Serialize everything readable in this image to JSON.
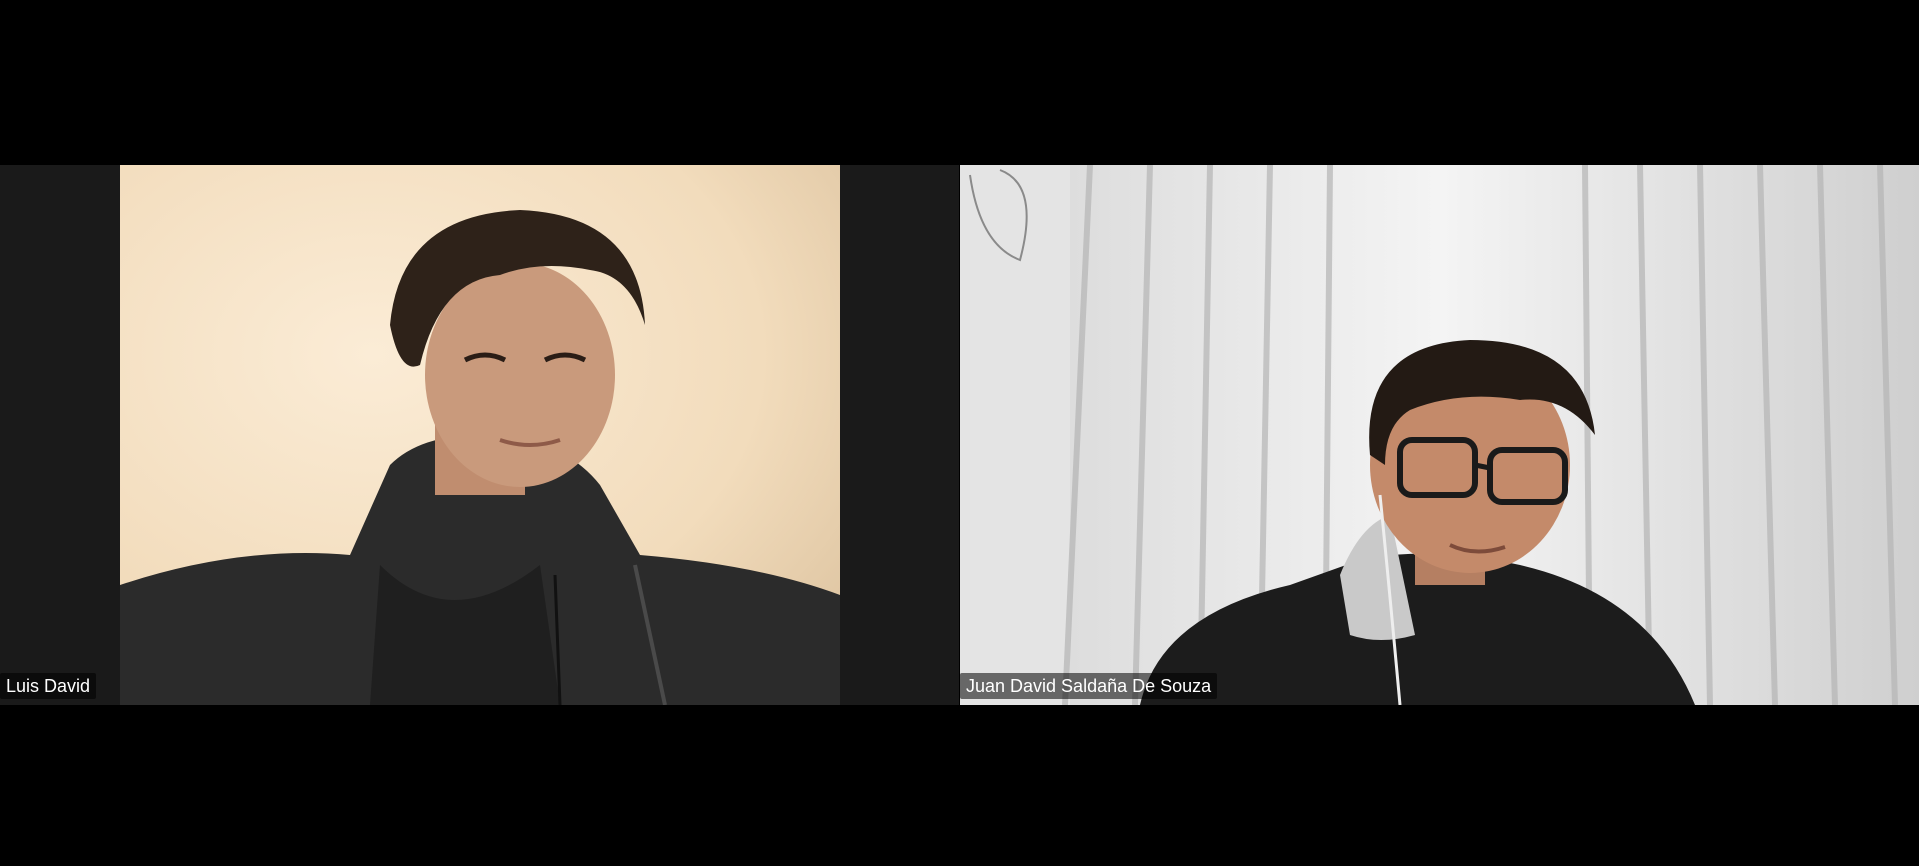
{
  "meeting": {
    "participants": [
      {
        "name": "Luis David"
      },
      {
        "name": "Juan David Saldaña De Souza"
      }
    ]
  },
  "colors": {
    "background": "#000000",
    "tile_background": "#1a1a1a",
    "name_text": "#ffffff"
  }
}
